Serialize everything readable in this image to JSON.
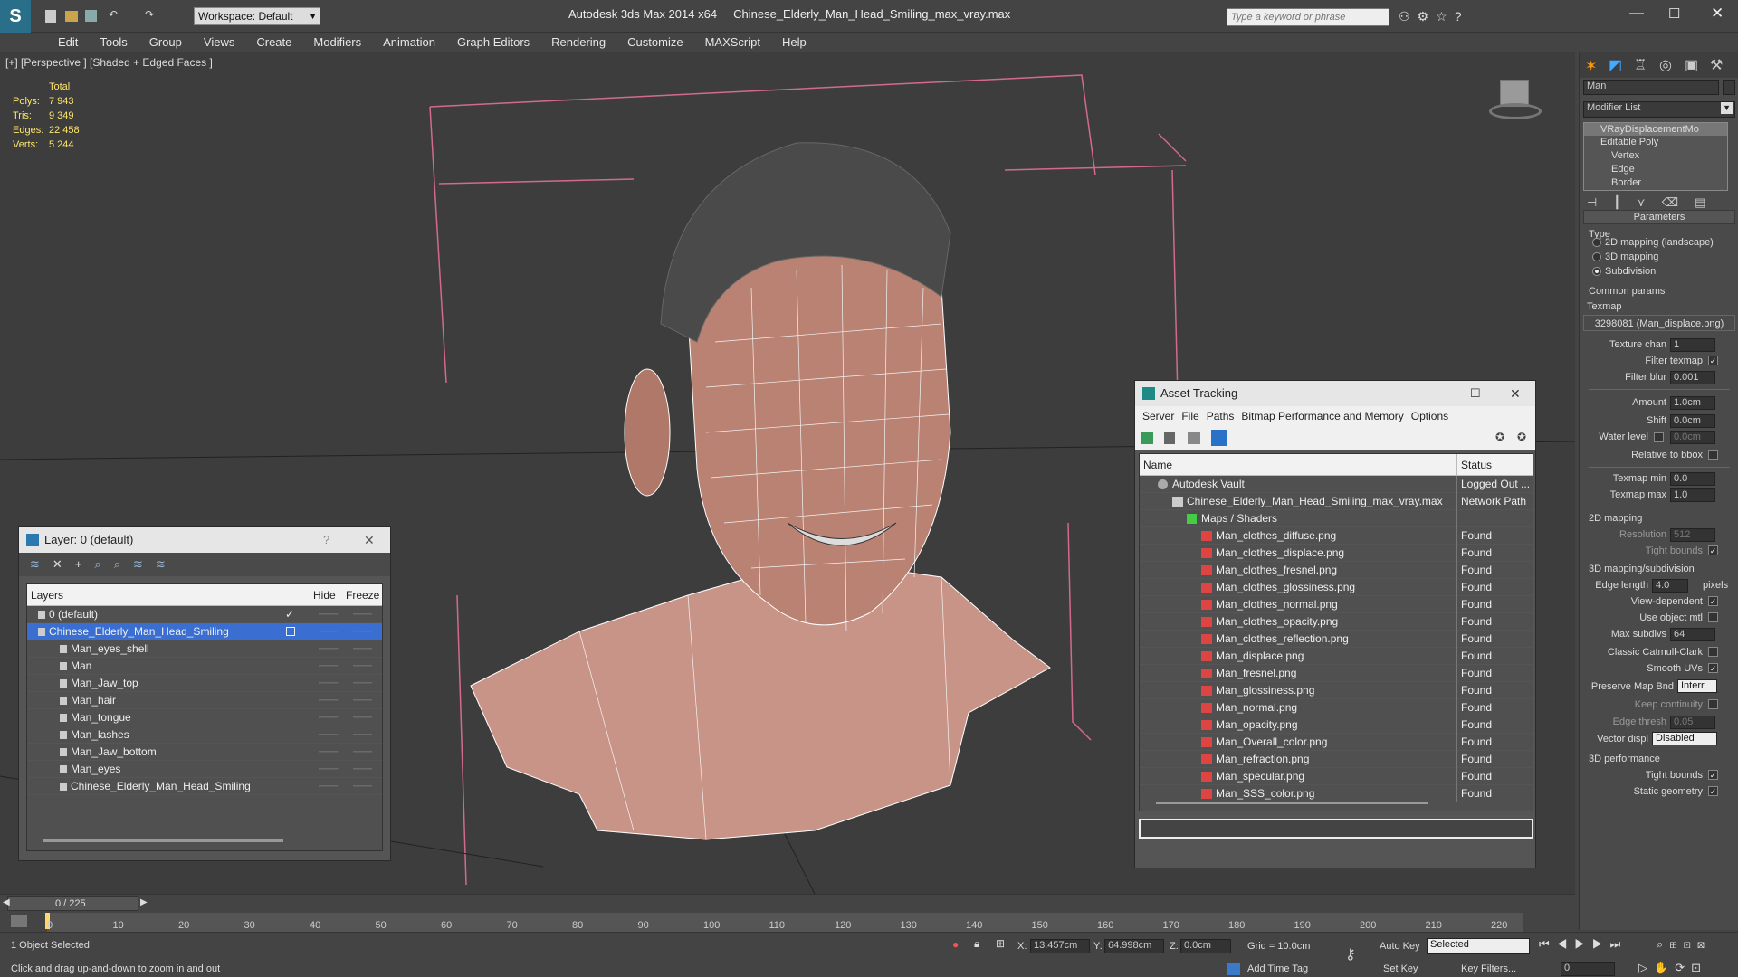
{
  "app": {
    "title": "Autodesk 3ds Max  2014 x64",
    "file": "Chinese_Elderly_Man_Head_Smiling_max_vray.max",
    "workspace": "Workspace: Default",
    "search_placeholder": "Type a keyword or phrase"
  },
  "menu": [
    "Edit",
    "Tools",
    "Group",
    "Views",
    "Create",
    "Modifiers",
    "Animation",
    "Graph Editors",
    "Rendering",
    "Customize",
    "MAXScript",
    "Help"
  ],
  "viewport": {
    "label": "[+] [Perspective ] [Shaded + Edged Faces ]",
    "stats": {
      "header": "Total",
      "rows": [
        {
          "k": "Polys:",
          "v": "7 943"
        },
        {
          "k": "Tris:",
          "v": "9 349"
        },
        {
          "k": "Edges:",
          "v": "22 458"
        },
        {
          "k": "Verts:",
          "v": "5 244"
        }
      ]
    }
  },
  "layer_window": {
    "title": "Layer: 0 (default)",
    "col_layers": "Layers",
    "col_hide": "Hide",
    "col_freeze": "Freeze",
    "help": "?",
    "items": [
      "0 (default)",
      "Chinese_Elderly_Man_Head_Smiling",
      "Man_eyes_shell",
      "Man",
      "Man_Jaw_top",
      "Man_hair",
      "Man_tongue",
      "Man_lashes",
      "Man_Jaw_bottom",
      "Man_eyes",
      "Chinese_Elderly_Man_Head_Smiling"
    ]
  },
  "asset_window": {
    "title": "Asset Tracking",
    "menu": [
      "Server",
      "File",
      "Paths",
      "Bitmap Performance and Memory",
      "Options"
    ],
    "col_name": "Name",
    "col_status": "Status",
    "rows": [
      {
        "name": "Autodesk Vault",
        "status": "Logged Out ..."
      },
      {
        "name": "Chinese_Elderly_Man_Head_Smiling_max_vray.max",
        "status": "Network Path"
      },
      {
        "name": "Maps / Shaders",
        "status": ""
      },
      {
        "name": "Man_clothes_diffuse.png",
        "status": "Found"
      },
      {
        "name": "Man_clothes_displace.png",
        "status": "Found"
      },
      {
        "name": "Man_clothes_fresnel.png",
        "status": "Found"
      },
      {
        "name": "Man_clothes_glossiness.png",
        "status": "Found"
      },
      {
        "name": "Man_clothes_normal.png",
        "status": "Found"
      },
      {
        "name": "Man_clothes_opacity.png",
        "status": "Found"
      },
      {
        "name": "Man_clothes_reflection.png",
        "status": "Found"
      },
      {
        "name": "Man_displace.png",
        "status": "Found"
      },
      {
        "name": "Man_fresnel.png",
        "status": "Found"
      },
      {
        "name": "Man_glossiness.png",
        "status": "Found"
      },
      {
        "name": "Man_normal.png",
        "status": "Found"
      },
      {
        "name": "Man_opacity.png",
        "status": "Found"
      },
      {
        "name": "Man_Overall_color.png",
        "status": "Found"
      },
      {
        "name": "Man_refraction.png",
        "status": "Found"
      },
      {
        "name": "Man_specular.png",
        "status": "Found"
      },
      {
        "name": "Man_SSS_color.png",
        "status": "Found"
      }
    ]
  },
  "command_panel": {
    "object_name": "Man",
    "modifier_list": "Modifier List",
    "stack": [
      "VRayDisplacementMo",
      "Editable Poly",
      "Vertex",
      "Edge",
      "Border"
    ],
    "parameters": "Parameters",
    "type": "Type",
    "type_options": [
      "2D mapping (landscape)",
      "3D mapping",
      "Subdivision"
    ],
    "common": "Common params",
    "texmap": "Texmap",
    "texmap_value": "3298081 (Man_displace.png)",
    "texture_chan": "Texture chan",
    "texture_chan_v": "1",
    "filter_texmap": "Filter texmap",
    "filter_blur": "Filter blur",
    "filter_blur_v": "0.001",
    "amount": "Amount",
    "amount_v": "1.0cm",
    "shift": "Shift",
    "shift_v": "0.0cm",
    "water_level": "Water level",
    "water_level_v": "0.0cm",
    "relative_bbox": "Relative to bbox",
    "texmap_min": "Texmap min",
    "texmap_min_v": "0.0",
    "texmap_max": "Texmap max",
    "texmap_max_v": "1.0",
    "map2d": "2D mapping",
    "resolution": "Resolution",
    "resolution_v": "512",
    "tight_bounds": "Tight bounds",
    "map3d": "3D mapping/subdivision",
    "edge_length": "Edge length",
    "edge_length_v": "4.0",
    "pixels": "pixels",
    "view_dep": "View-dependent",
    "use_obj": "Use object mtl",
    "max_subdivs": "Max subdivs",
    "max_subdivs_v": "64",
    "catmull": "Classic Catmull-Clark",
    "smooth_uvs": "Smooth UVs",
    "preserve": "Preserve Map Bnd",
    "preserve_v": "Interr",
    "keep_cont": "Keep continuity",
    "edge_thresh": "Edge thresh",
    "edge_thresh_v": "0.05",
    "vector_displ": "Vector displ",
    "vector_displ_v": "Disabled",
    "perf": "3D performance",
    "tight_bounds2": "Tight bounds",
    "static_geo": "Static geometry"
  },
  "timeline": {
    "frame": "0 / 225",
    "ticks": [
      "0",
      "10",
      "20",
      "30",
      "40",
      "50",
      "60",
      "70",
      "80",
      "90",
      "100",
      "110",
      "120",
      "130",
      "140",
      "150",
      "160",
      "170",
      "180",
      "190",
      "200",
      "210",
      "220"
    ]
  },
  "status": {
    "selected": "1 Object Selected",
    "hint": "Click and drag up-and-down to zoom in and out",
    "x_label": "X:",
    "x": "13.457cm",
    "y_label": "Y:",
    "y": "64.998cm",
    "z_label": "Z:",
    "z": "0.0cm",
    "grid": "Grid = 10.0cm",
    "add_time_tag": "Add Time Tag",
    "auto_key": "Auto Key",
    "set_key": "Set Key",
    "selected_dd": "Selected",
    "key_filters": "Key Filters...",
    "frame_field": "0"
  }
}
